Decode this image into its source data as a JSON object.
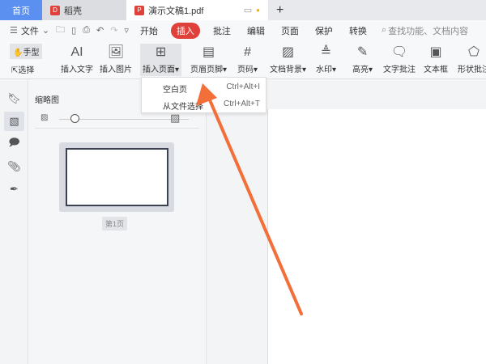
{
  "tabs": [
    {
      "label": "首页"
    },
    {
      "label": "稻壳"
    },
    {
      "label": "演示文稿1.pdf"
    }
  ],
  "menubar": {
    "file": "文件",
    "items": [
      "开始",
      "插入",
      "批注",
      "编辑",
      "页面",
      "保护",
      "转换"
    ],
    "active": "插入",
    "search_placeholder": "查找功能、文档内容"
  },
  "ribbon": {
    "hand": "手型",
    "select": "选择",
    "items": [
      "插入文字",
      "插入图片",
      "插入页面",
      "页眉页脚",
      "页码",
      "文档背景",
      "水印",
      "高亮",
      "文字批注",
      "文本框",
      "形状批注"
    ]
  },
  "dropdown": {
    "items": [
      {
        "label": "空白页",
        "shortcut": "Ctrl+Alt+I"
      },
      {
        "label": "从文件选择",
        "shortcut": "Ctrl+Alt+T"
      }
    ]
  },
  "panel": {
    "title": "缩略图",
    "page_label": "第1页"
  },
  "colors": {
    "accent": "#e0403a",
    "home_tab": "#5b8ff0",
    "arrow": "#f36f3a"
  }
}
